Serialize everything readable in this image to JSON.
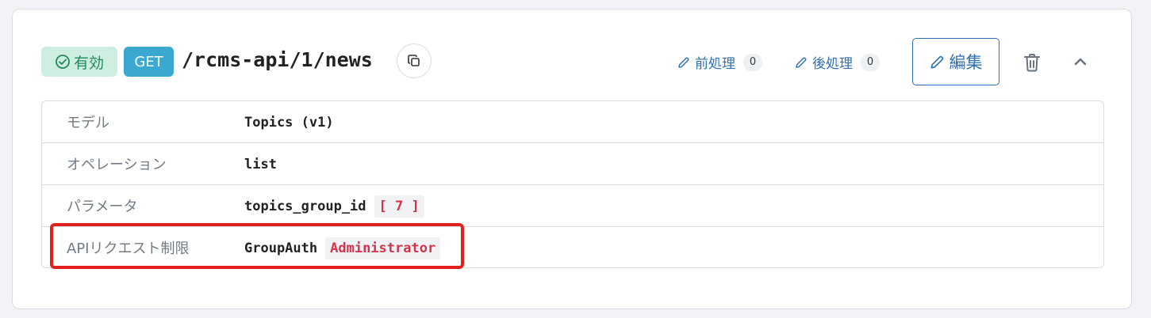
{
  "header": {
    "status_badge": "有効",
    "method_badge": "GET",
    "path": "/rcms-api/1/news",
    "preprocess_label": "前処理",
    "preprocess_count": "0",
    "postprocess_label": "後処理",
    "postprocess_count": "0",
    "edit_label": "編集"
  },
  "colors": {
    "status_bg": "#cdeee0",
    "status_fg": "#1f8a5b",
    "method_bg": "#3aa8d1",
    "accent": "#2f6fb5",
    "chip_fg": "#d6334b",
    "highlight": "#e0201c"
  },
  "icons": [
    "check-circle-icon",
    "copy-icon",
    "pencil-icon",
    "trash-icon",
    "chevron-up-icon"
  ],
  "details": {
    "model": {
      "label": "モデル",
      "value": "Topics (v1)"
    },
    "operation": {
      "label": "オペレーション",
      "value": "list"
    },
    "params": {
      "label": "パラメータ",
      "name": "topics_group_id",
      "value": "[ 7 ]"
    },
    "restriction": {
      "label": "APIリクエスト制限",
      "name": "GroupAuth",
      "value": "Administrator"
    }
  }
}
